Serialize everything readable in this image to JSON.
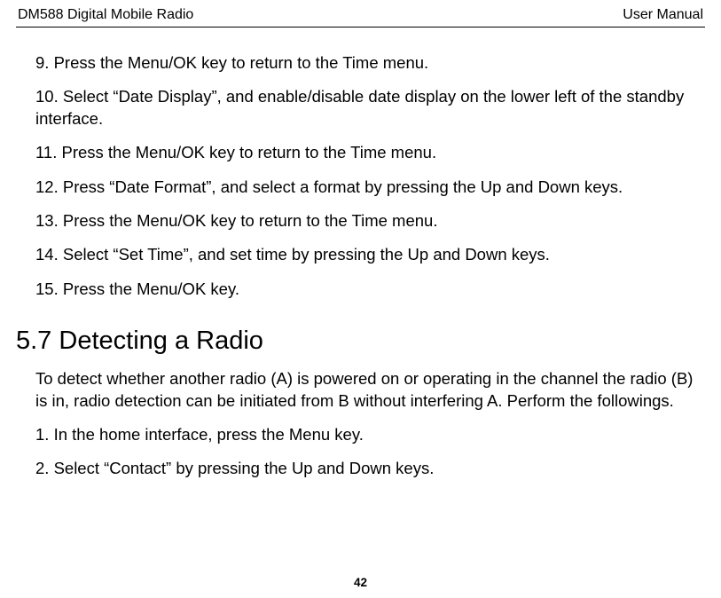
{
  "header": {
    "left": "DM588 Digital Mobile Radio",
    "right": "User Manual"
  },
  "steps_a": [
    "9. Press the Menu/OK key to return to the Time menu.",
    "10. Select “Date Display”, and enable/disable date display on the lower left of the standby interface.",
    "11. Press the Menu/OK key to return to the Time menu.",
    "12. Press “Date Format”, and select a format by pressing the Up and Down keys.",
    "13. Press the Menu/OK key to return to the Time menu.",
    "14. Select “Set Time”, and set time by pressing the Up and Down keys.",
    "15. Press the Menu/OK key."
  ],
  "section": {
    "number": "5.7",
    "title": "Detecting a Radio",
    "intro": "To detect whether another radio (A) is powered on or operating in the channel the radio (B) is in, radio detection can be initiated from B without interfering A. Perform the followings.",
    "steps": [
      "1. In the home interface, press the Menu key.",
      "2. Select “Contact” by pressing the Up and Down keys."
    ]
  },
  "page_number": "42"
}
